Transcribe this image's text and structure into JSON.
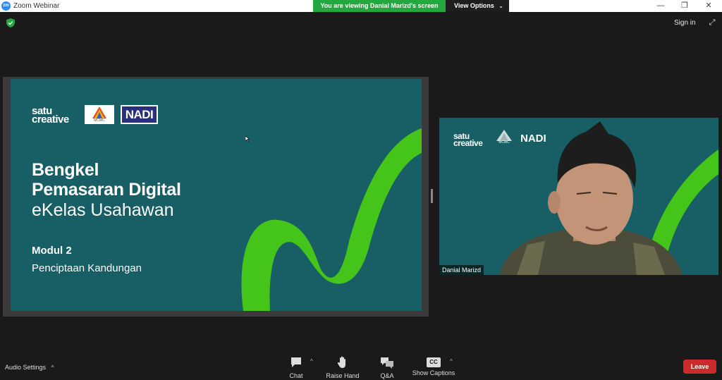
{
  "titlebar": {
    "logo": "zm",
    "title": "Zoom Webinar",
    "minimize": "—",
    "restore": "❐",
    "close": "✕"
  },
  "share_banner": {
    "viewing_text": "You are viewing Danial Marizd's screen",
    "view_options_label": "View Options",
    "chevron": "⌄"
  },
  "header": {
    "sign_in_label": "Sign in",
    "fullscreen_glyph": "⤢"
  },
  "slide": {
    "logo_satu_line1": "satu",
    "logo_satu_line2": "creative",
    "logo_mcmc": "MCMC",
    "logo_nadi": "NADI",
    "title_line1": "Bengkel",
    "title_line2": "Pemasaran Digital",
    "subtitle": "eKelas Usahawan",
    "module": "Modul 2",
    "module_subtitle": "Penciptaan Kandungan"
  },
  "video": {
    "logo_satu_line1": "satu",
    "logo_satu_line2": "creative",
    "logo_mcmc": "MCMC",
    "logo_nadi": "NADI",
    "participant_name": "Danial Marizd"
  },
  "toolbar": {
    "audio_settings_label": "Audio Settings",
    "audio_caret": "^",
    "chat_label": "Chat",
    "chat_caret": "^",
    "raise_hand_label": "Raise Hand",
    "qa_label": "Q&A",
    "captions_label": "Show Captions",
    "captions_icon_text": "CC",
    "captions_caret": "^",
    "leave_label": "Leave"
  },
  "colors": {
    "accent_green": "#23a840",
    "slide_teal": "#175f65",
    "lime": "#45c41a",
    "leave_red": "#cc2b2b",
    "nadi_navy": "#2a2f7c"
  }
}
